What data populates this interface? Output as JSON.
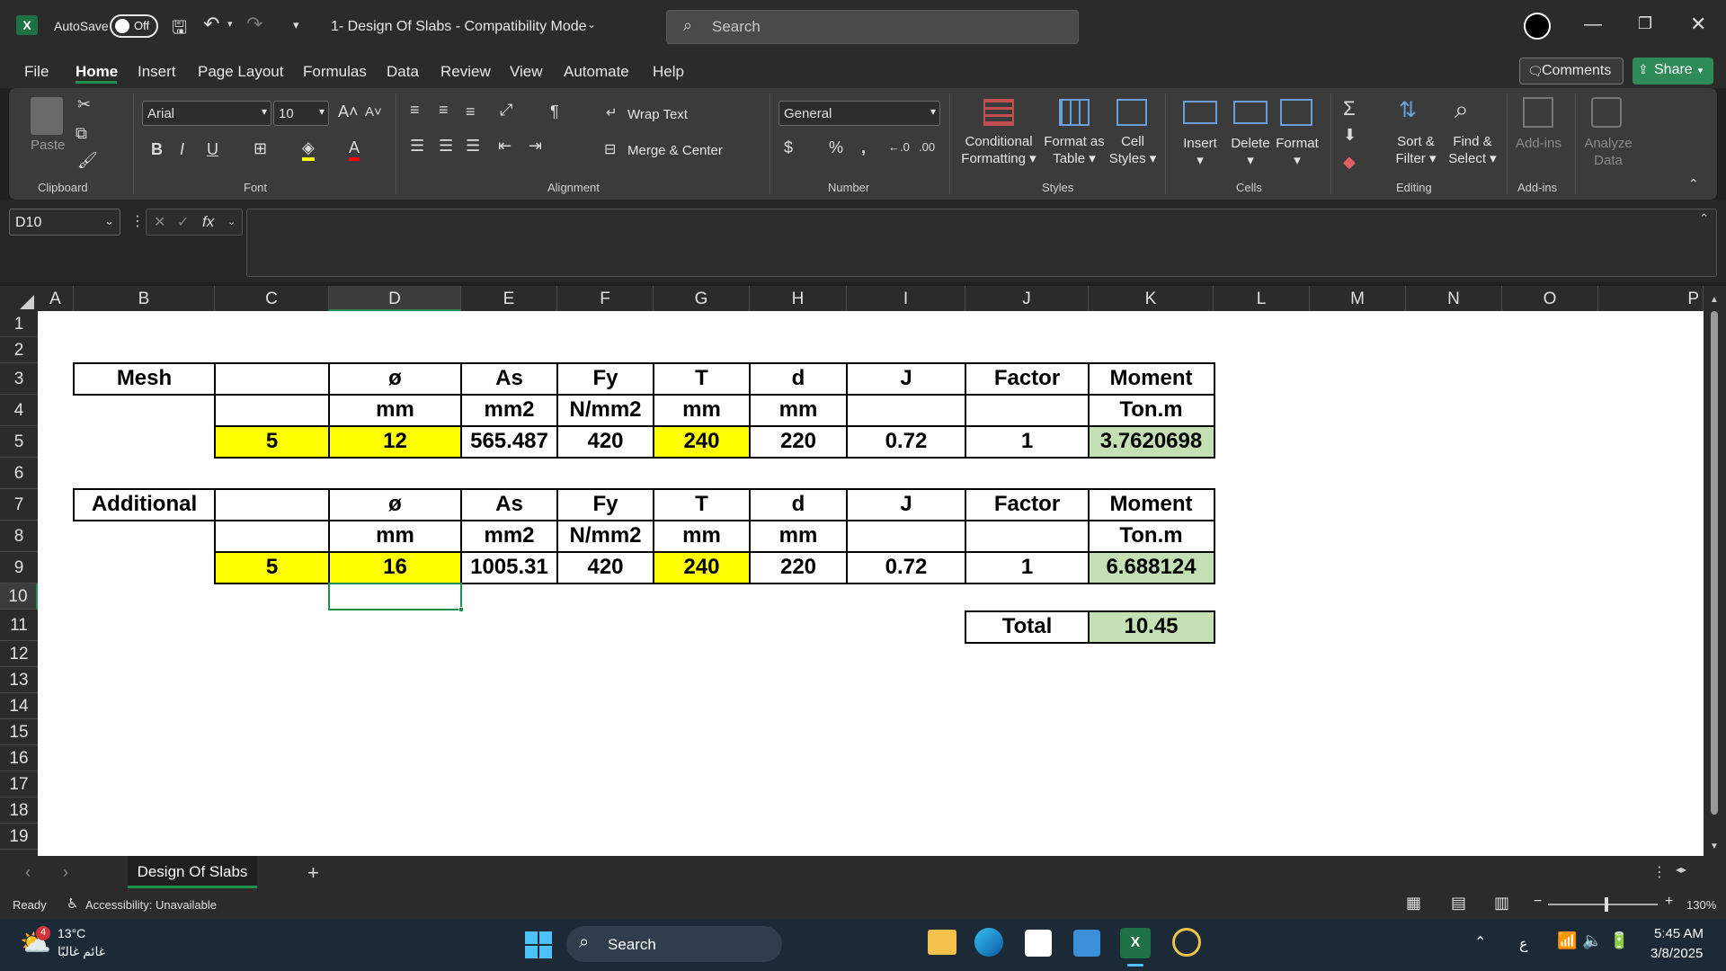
{
  "titlebar": {
    "autosave_label": "AutoSave",
    "autosave_state": "Off",
    "doc_title": "1- Design Of Slabs  -  Compatibility Mode",
    "search_placeholder": "Search"
  },
  "menu": [
    "File",
    "Home",
    "Insert",
    "Page Layout",
    "Formulas",
    "Data",
    "Review",
    "View",
    "Automate",
    "Help"
  ],
  "buttons": {
    "comments": "Comments",
    "share": "Share"
  },
  "ribbon": {
    "clipboard": {
      "paste": "Paste",
      "label": "Clipboard"
    },
    "font": {
      "name": "Arial",
      "size": "10",
      "label": "Font"
    },
    "alignment": {
      "wrap": "Wrap Text",
      "merge": "Merge & Center",
      "label": "Alignment"
    },
    "number": {
      "format": "General",
      "label": "Number"
    },
    "styles": {
      "cond1": "Conditional",
      "cond2": "Formatting",
      "fmt1": "Format as",
      "fmt2": "Table",
      "cell1": "Cell",
      "cell2": "Styles",
      "label": "Styles"
    },
    "cells": {
      "insert": "Insert",
      "delete": "Delete",
      "format": "Format",
      "label": "Cells"
    },
    "editing": {
      "sort1": "Sort &",
      "sort2": "Filter",
      "find1": "Find &",
      "find2": "Select",
      "label": "Editing"
    },
    "addins": {
      "addins": "Add-ins",
      "analyze1": "Analyze",
      "analyze2": "Data",
      "label": "Add-ins"
    }
  },
  "formula_bar": {
    "name_box": "D10",
    "fx": "fx",
    "content": ""
  },
  "columns": [
    "A",
    "B",
    "C",
    "D",
    "E",
    "F",
    "G",
    "H",
    "I",
    "J",
    "K",
    "L",
    "M",
    "N",
    "O",
    "P"
  ],
  "rows": [
    "1",
    "2",
    "3",
    "4",
    "5",
    "6",
    "7",
    "8",
    "9",
    "10",
    "11",
    "12",
    "13",
    "14",
    "15",
    "16",
    "17",
    "18",
    "19"
  ],
  "sheet": {
    "headers": {
      "dia": "ø",
      "as": "As",
      "fy": "Fy",
      "t": "T",
      "d": "d",
      "j": "J",
      "factor": "Factor",
      "moment": "Moment"
    },
    "units": {
      "dia": "mm",
      "as": "mm2",
      "fy": "N/mm2",
      "t": "mm",
      "d": "mm",
      "moment": "Ton.m"
    },
    "mesh": {
      "label": "Mesh",
      "count": "5",
      "dia": "12",
      "as": "565.487",
      "fy": "420",
      "t": "240",
      "d": "220",
      "j": "0.72",
      "factor": "1",
      "moment": "3.7620698"
    },
    "additional": {
      "label": "Additional",
      "count": "5",
      "dia": "16",
      "as": "1005.31",
      "fy": "420",
      "t": "240",
      "d": "220",
      "j": "0.72",
      "factor": "1",
      "moment": "6.688124"
    },
    "total": {
      "label": "Total",
      "value": "10.45"
    }
  },
  "tabs": {
    "active": "Design Of Slabs",
    "add": "+"
  },
  "status": {
    "ready": "Ready",
    "accessibility": "Accessibility: Unavailable",
    "zoom": "130%"
  },
  "taskbar": {
    "temp": "13°C",
    "weather": "غائم غالبًا",
    "badge": "4",
    "search": "Search",
    "time": "5:45 AM",
    "date": "3/8/2025",
    "lang": "ع"
  },
  "colors": {
    "accent": "#1e8f4e",
    "yellow": "#ffff00",
    "green": "#c4e0b4"
  }
}
